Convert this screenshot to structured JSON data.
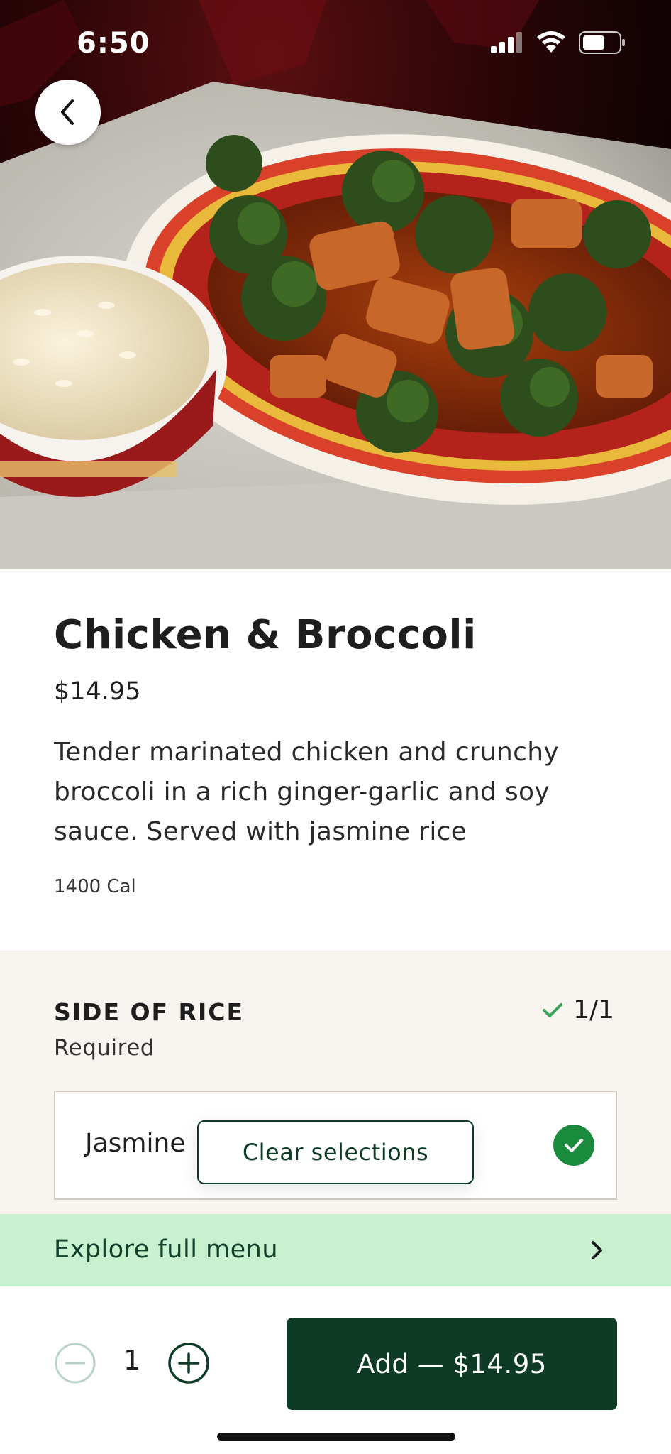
{
  "status_bar": {
    "time": "6:50",
    "icons": [
      "signal-icon",
      "wifi-icon",
      "battery-icon"
    ]
  },
  "hero": {
    "back_icon": "chevron-left-icon",
    "image": "chicken-broccoli-photo"
  },
  "item": {
    "title": "Chicken & Broccoli",
    "price": "$14.95",
    "description": "Tender marinated chicken and crunchy broccoli in a rich ginger-garlic and soy sauce. Served with jasmine rice",
    "calories": "1400 Cal"
  },
  "options": {
    "heading": "SIDE OF RICE",
    "required": "Required",
    "count": "1/1",
    "choices": [
      {
        "name": "Jasmine",
        "selected": true
      }
    ],
    "clear_label": "Clear selections"
  },
  "explore": {
    "label": "Explore full menu"
  },
  "cart": {
    "quantity": "1",
    "add_label": "Add — $14.95"
  },
  "colors": {
    "brand_dark_green": "#0d3b26",
    "check_green": "#1a8a3c",
    "explore_bg": "#c9f0cf",
    "options_bg": "#f8f4ef"
  }
}
